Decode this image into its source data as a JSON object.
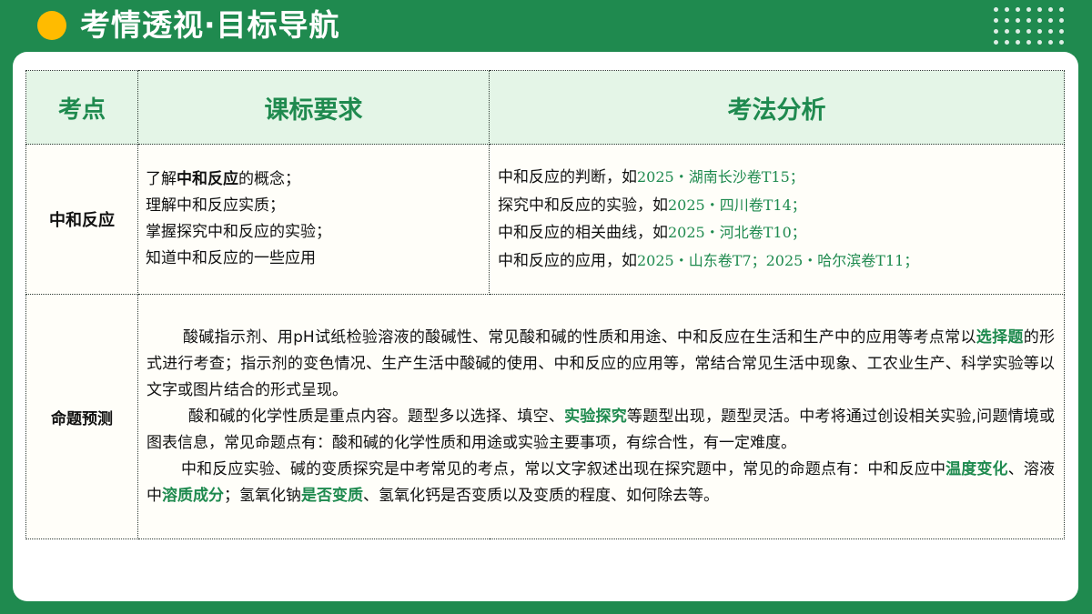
{
  "title": "考情透视·目标导航",
  "colors": {
    "brand_green": "#1f8a4f",
    "accent_yellow": "#ffbb00",
    "header_bg": "#e4f5e7"
  },
  "table": {
    "headers": [
      "考点",
      "课标要求",
      "考法分析"
    ],
    "row1": {
      "label": "中和反应",
      "requirements": {
        "line1_pre": "了解",
        "line1_bold": "中和反应",
        "line1_post": "的概念；",
        "line2": "理解中和反应实质；",
        "line3": "掌握探究中和反应的实验；",
        "line4": "知道中和反应的一些应用"
      },
      "analysis": [
        {
          "text": "中和反应的判断，如",
          "source": "2025・湖南长沙卷T15；"
        },
        {
          "text": "探究中和反应的实验，如",
          "source": "2025・四川卷T14；"
        },
        {
          "text": "中和反应的相关曲线，如",
          "source": "2025・河北卷T10；"
        },
        {
          "text": "中和反应的应用，如",
          "source": "2025・山东卷T7；",
          "source2": "2025・哈尔滨卷T11；"
        }
      ]
    },
    "row2": {
      "label": "命题预测",
      "p1": {
        "a": "酸碱指示剂、用pH试纸检验溶液的酸碱性、常见酸和碱的性质和用途、中和反应在生活和生产中的应用等考点常以",
        "em": "选择题",
        "b": "的形式进行考查；指示剂的变色情况、生产生活中酸碱的使用、中和反应的应用等，常结合常见生活中现象、工农业生产、科学实验等以文字或图片结合的形式呈现。"
      },
      "p2": {
        "a": "酸和碱的化学性质是重点内容。题型多以选择、填空、",
        "em": "实验探究",
        "b": "等题型出现，题型灵活。中考将通过创设相关实验,问题情境或图表信息，常见命题点有：酸和碱的化学性质和用途或实验主要事项，有综合性，有一定难度。"
      },
      "p3": {
        "a": "中和反应实验、碱的变质探究是中考常见的考点，常以文字叙述出现在探究题中，常见的命题点有：中和反应中",
        "em1": "温度变化",
        "b": "、溶液中",
        "em2": "溶质成分",
        "c": "；氢氧化钠",
        "em3": "是否变质",
        "d": "、氢氧化钙是否变质以及变质的程度、如何除去等。"
      }
    }
  }
}
